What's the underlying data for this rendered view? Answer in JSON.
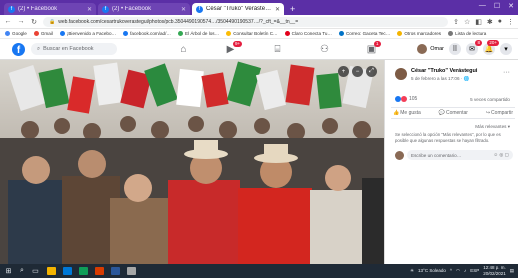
{
  "browser": {
    "tabs": [
      {
        "title": "(2) • Facebook",
        "active": false
      },
      {
        "title": "(2) • Facebook",
        "active": false
      },
      {
        "title": "César \"Truko\" Verástegui agrega…",
        "active": true
      }
    ],
    "url": "web.facebook.com/cesartrukoverastegui/photos/pcb.3504490190574…/3504490190537…/?_cft_=&__tn__=",
    "bookmarks": [
      "Google",
      "Gmail",
      "¡Bienvenido a Facebo…",
      "facebook.com/ad/…",
      "El Árbol de los…",
      "Consultar Boletín C…",
      "Claro Conecta Tu…",
      "Correo: Gaceta Tec…",
      "Otros marcadores",
      "Lista de lectura"
    ]
  },
  "facebook": {
    "search_placeholder": "Buscar en Facebook",
    "nav_badges": {
      "watch": "9+",
      "groups": "1"
    },
    "profile_name": "Omar",
    "notif_badges": {
      "messenger": "8",
      "alerts": "20+"
    }
  },
  "post": {
    "author": "César \"Truko\" Verástegui",
    "date": "5 de febrero a las 17:06 · 🌐",
    "reactions_count": "105",
    "shares": "5 veces compartido",
    "actions": [
      "Me gusta",
      "Comentar",
      "Compartir"
    ],
    "sort": "Más relevantes ▾",
    "notice": "Se seleccionó la opción \"Más relevantes\", por lo que es posible que algunas respuestas se hayan filtrado.",
    "comment_placeholder": "Escribe un comentario…"
  },
  "taskbar": {
    "weather": "13°C Soleado",
    "time": "12:48 p. m.",
    "date": "20/02/2021",
    "lang": "ESP"
  },
  "colors": {
    "browser_frame": "#5b2fa6",
    "facebook_blue": "#1877f2",
    "taskbar": "#1f2a36"
  }
}
